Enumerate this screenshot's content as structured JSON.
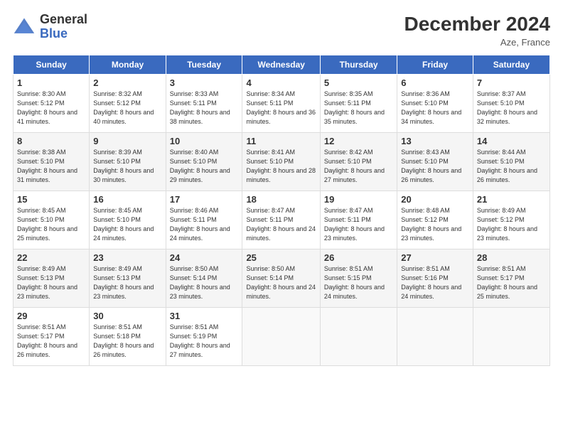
{
  "logo": {
    "general": "General",
    "blue": "Blue"
  },
  "header": {
    "title": "December 2024",
    "location": "Aze, France"
  },
  "weekdays": [
    "Sunday",
    "Monday",
    "Tuesday",
    "Wednesday",
    "Thursday",
    "Friday",
    "Saturday"
  ],
  "weeks": [
    [
      {
        "day": "1",
        "sunrise": "8:30 AM",
        "sunset": "5:12 PM",
        "daylight": "8 hours and 41 minutes."
      },
      {
        "day": "2",
        "sunrise": "8:32 AM",
        "sunset": "5:12 PM",
        "daylight": "8 hours and 40 minutes."
      },
      {
        "day": "3",
        "sunrise": "8:33 AM",
        "sunset": "5:11 PM",
        "daylight": "8 hours and 38 minutes."
      },
      {
        "day": "4",
        "sunrise": "8:34 AM",
        "sunset": "5:11 PM",
        "daylight": "8 hours and 36 minutes."
      },
      {
        "day": "5",
        "sunrise": "8:35 AM",
        "sunset": "5:11 PM",
        "daylight": "8 hours and 35 minutes."
      },
      {
        "day": "6",
        "sunrise": "8:36 AM",
        "sunset": "5:10 PM",
        "daylight": "8 hours and 34 minutes."
      },
      {
        "day": "7",
        "sunrise": "8:37 AM",
        "sunset": "5:10 PM",
        "daylight": "8 hours and 32 minutes."
      }
    ],
    [
      {
        "day": "8",
        "sunrise": "8:38 AM",
        "sunset": "5:10 PM",
        "daylight": "8 hours and 31 minutes."
      },
      {
        "day": "9",
        "sunrise": "8:39 AM",
        "sunset": "5:10 PM",
        "daylight": "8 hours and 30 minutes."
      },
      {
        "day": "10",
        "sunrise": "8:40 AM",
        "sunset": "5:10 PM",
        "daylight": "8 hours and 29 minutes."
      },
      {
        "day": "11",
        "sunrise": "8:41 AM",
        "sunset": "5:10 PM",
        "daylight": "8 hours and 28 minutes."
      },
      {
        "day": "12",
        "sunrise": "8:42 AM",
        "sunset": "5:10 PM",
        "daylight": "8 hours and 27 minutes."
      },
      {
        "day": "13",
        "sunrise": "8:43 AM",
        "sunset": "5:10 PM",
        "daylight": "8 hours and 26 minutes."
      },
      {
        "day": "14",
        "sunrise": "8:44 AM",
        "sunset": "5:10 PM",
        "daylight": "8 hours and 26 minutes."
      }
    ],
    [
      {
        "day": "15",
        "sunrise": "8:45 AM",
        "sunset": "5:10 PM",
        "daylight": "8 hours and 25 minutes."
      },
      {
        "day": "16",
        "sunrise": "8:45 AM",
        "sunset": "5:10 PM",
        "daylight": "8 hours and 24 minutes."
      },
      {
        "day": "17",
        "sunrise": "8:46 AM",
        "sunset": "5:11 PM",
        "daylight": "8 hours and 24 minutes."
      },
      {
        "day": "18",
        "sunrise": "8:47 AM",
        "sunset": "5:11 PM",
        "daylight": "8 hours and 24 minutes."
      },
      {
        "day": "19",
        "sunrise": "8:47 AM",
        "sunset": "5:11 PM",
        "daylight": "8 hours and 23 minutes."
      },
      {
        "day": "20",
        "sunrise": "8:48 AM",
        "sunset": "5:12 PM",
        "daylight": "8 hours and 23 minutes."
      },
      {
        "day": "21",
        "sunrise": "8:49 AM",
        "sunset": "5:12 PM",
        "daylight": "8 hours and 23 minutes."
      }
    ],
    [
      {
        "day": "22",
        "sunrise": "8:49 AM",
        "sunset": "5:13 PM",
        "daylight": "8 hours and 23 minutes."
      },
      {
        "day": "23",
        "sunrise": "8:49 AM",
        "sunset": "5:13 PM",
        "daylight": "8 hours and 23 minutes."
      },
      {
        "day": "24",
        "sunrise": "8:50 AM",
        "sunset": "5:14 PM",
        "daylight": "8 hours and 23 minutes."
      },
      {
        "day": "25",
        "sunrise": "8:50 AM",
        "sunset": "5:14 PM",
        "daylight": "8 hours and 24 minutes."
      },
      {
        "day": "26",
        "sunrise": "8:51 AM",
        "sunset": "5:15 PM",
        "daylight": "8 hours and 24 minutes."
      },
      {
        "day": "27",
        "sunrise": "8:51 AM",
        "sunset": "5:16 PM",
        "daylight": "8 hours and 24 minutes."
      },
      {
        "day": "28",
        "sunrise": "8:51 AM",
        "sunset": "5:17 PM",
        "daylight": "8 hours and 25 minutes."
      }
    ],
    [
      {
        "day": "29",
        "sunrise": "8:51 AM",
        "sunset": "5:17 PM",
        "daylight": "8 hours and 26 minutes."
      },
      {
        "day": "30",
        "sunrise": "8:51 AM",
        "sunset": "5:18 PM",
        "daylight": "8 hours and 26 minutes."
      },
      {
        "day": "31",
        "sunrise": "8:51 AM",
        "sunset": "5:19 PM",
        "daylight": "8 hours and 27 minutes."
      },
      null,
      null,
      null,
      null
    ]
  ],
  "labels": {
    "sunrise": "Sunrise:",
    "sunset": "Sunset:",
    "daylight": "Daylight:"
  }
}
